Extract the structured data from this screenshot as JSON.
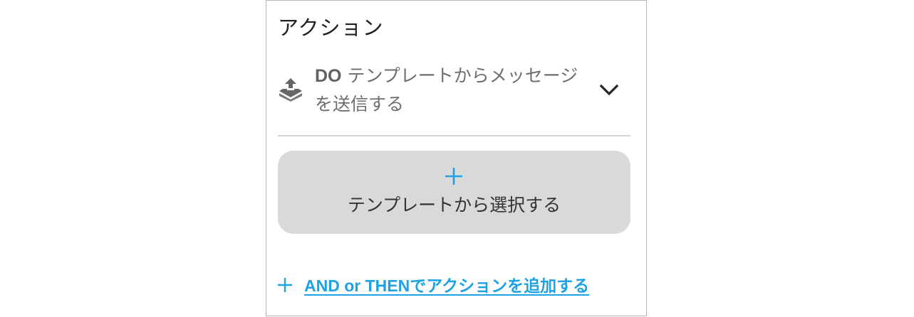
{
  "section": {
    "title": "アクション"
  },
  "action": {
    "prefix": "DO",
    "text": "テンプレートからメッセージを送信する",
    "icon": "upload-tray-icon",
    "expand_icon": "chevron-down-icon"
  },
  "template_button": {
    "icon": "plus-icon",
    "label": "テンプレートから選択する"
  },
  "add_action": {
    "icon": "plus-icon",
    "label": "AND or THENでアクションを追加する"
  },
  "colors": {
    "accent": "#1ea2e6",
    "button_bg": "#d9d9d9",
    "divider": "#d4d4d4",
    "border": "#b5b5b5"
  }
}
